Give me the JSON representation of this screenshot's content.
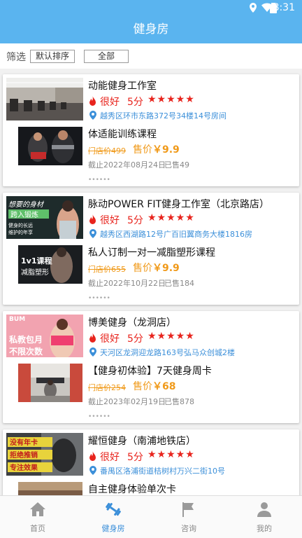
{
  "statusbar": {
    "time": "8:31"
  },
  "header": {
    "title": "健身房"
  },
  "filter": {
    "label": "筛选",
    "sort": "默认排序",
    "category": "全部"
  },
  "gyms": [
    {
      "name": "动能健身工作室",
      "rating": "很好",
      "score": "5分",
      "stars": "★★★★★",
      "address": "越秀区环市东路372号34楼14号房间",
      "course": {
        "name": "体适能训练课程",
        "original_price": "门店价499",
        "price_label": "售价",
        "price": "￥9.9",
        "deadline": "截止2022年08月24日",
        "sold": "已售49"
      },
      "more": "••••••"
    },
    {
      "name": "脉动POWER FIT健身工作室（北京路店）",
      "rating": "很好",
      "score": "5分",
      "stars": "★★★★★",
      "address": "越秀区西湖路12号广百旧翼商务大楼1816房",
      "image_text": [
        "想要的身材",
        "跨入锻炼",
        "健身的长远",
        "维护的年享"
      ],
      "course": {
        "name": "私人订制一对一减脂塑形课程",
        "original_price": "门店价655",
        "price_label": "售价",
        "price": "￥9.9",
        "deadline": "截止2022年10月22日",
        "sold": "已售184",
        "image_text": [
          "1v1课程",
          "减脂塑形"
        ]
      },
      "more": "••••••"
    },
    {
      "name": "博美健身（龙洞店）",
      "rating": "很好",
      "score": "5分",
      "stars": "★★★★★",
      "address": "天河区龙洞迎龙路163号弘马众创城2楼",
      "image_text": [
        "BUM",
        "私教包月",
        "不限次数"
      ],
      "course": {
        "name": "【健身初体验】7天健身周卡",
        "original_price": "门店价254",
        "price_label": "售价",
        "price": "￥68",
        "deadline": "截止2023年02月19日",
        "sold": "已售878"
      },
      "more": "••••••"
    },
    {
      "name": "耀恒健身（南浦地铁店）",
      "rating": "很好",
      "score": "5分",
      "stars": "★★★★★",
      "address": "番禺区洛浦街道桔树村万兴二街10号",
      "image_text": [
        "没有年卡",
        "拒绝推销",
        "专注效果"
      ],
      "course": {
        "name": "自主健身体验单次卡"
      }
    }
  ],
  "tabs": [
    {
      "label": "首页",
      "icon": "home-icon"
    },
    {
      "label": "健身房",
      "icon": "dumbbell-icon",
      "active": true
    },
    {
      "label": "咨询",
      "icon": "flag-icon"
    },
    {
      "label": "我的",
      "icon": "user-icon"
    }
  ],
  "colors": {
    "primary": "#5ab4ef",
    "price": "#f09a1a",
    "rating": "#e8241d",
    "address": "#3b8fd9"
  }
}
